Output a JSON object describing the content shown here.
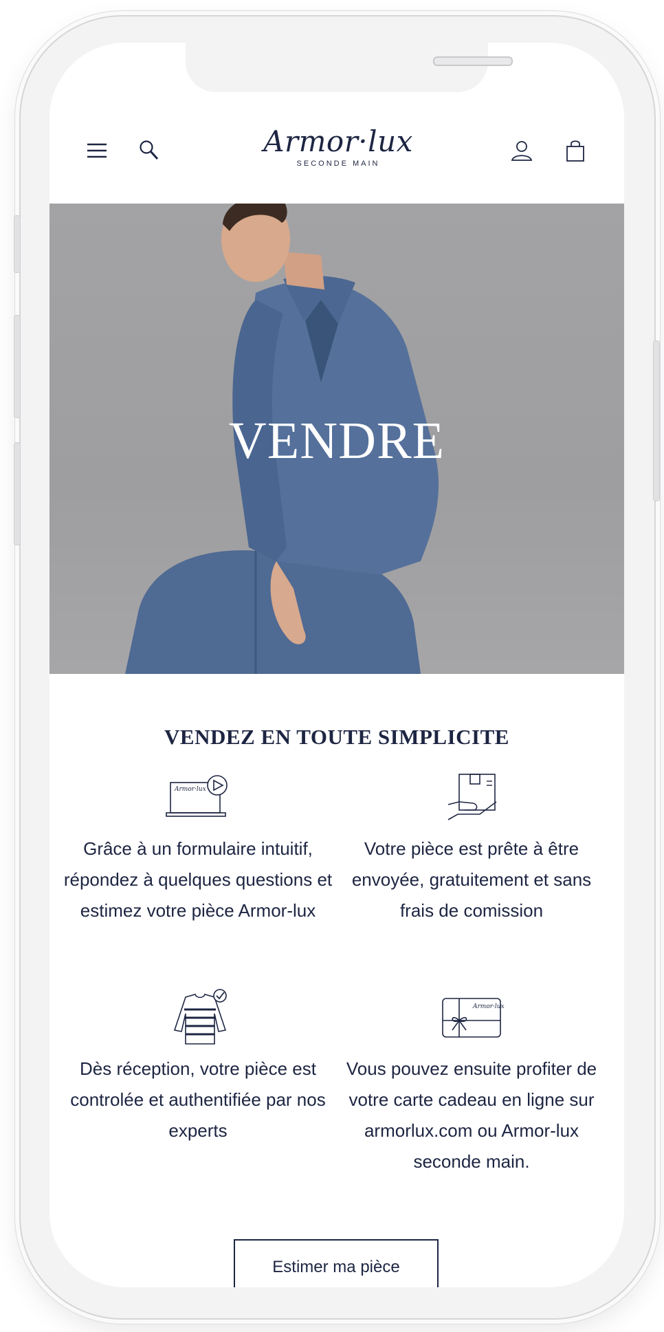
{
  "header": {
    "logo_main": "Armor·lux",
    "logo_sub": "SECONDE MAIN"
  },
  "hero": {
    "title": "VENDRE"
  },
  "section": {
    "title": "VENDEZ EN TOUTE SIMPLICITE"
  },
  "steps": [
    {
      "icon": "laptop-form-icon",
      "text": "Grâce à un formulaire intuitif, répondez à quelques questions et estimez votre pièce Armor-lux"
    },
    {
      "icon": "package-hand-icon",
      "text": "Votre pièce est prête à être envoyée, gratuitement et sans frais de comission"
    },
    {
      "icon": "striped-sweater-check-icon",
      "text": "Dès réception, votre pièce est controlée et authentifiée par nos experts"
    },
    {
      "icon": "gift-card-icon",
      "text": "Vous pouvez ensuite profiter de votre carte cadeau en ligne sur armorlux.com ou Armor-lux seconde main."
    }
  ],
  "icon_labels": {
    "laptop_brand": "Armor·lux",
    "gift_card_brand": "Armor·lux"
  },
  "cta": {
    "label": "Estimer ma pièce"
  },
  "colors": {
    "navy": "#1d2542",
    "hero_bg": "#a3a3a5",
    "denim": "#4f6a93"
  }
}
